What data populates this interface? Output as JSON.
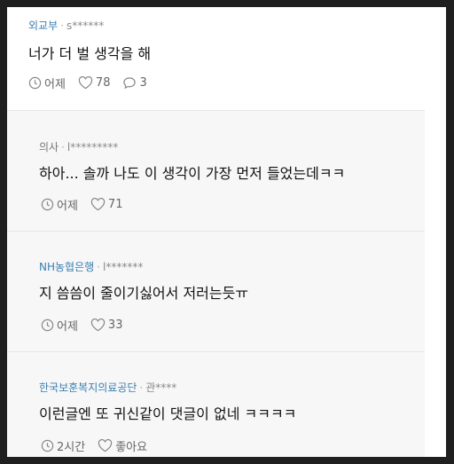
{
  "comments": [
    {
      "author": "외교부",
      "user": "s******",
      "text": "너가 더 벌 생각을 해",
      "time": "어제",
      "likes": "78",
      "replies": "3"
    },
    {
      "author": "의사",
      "user": "l*********",
      "text": "하아... 솔까 나도 이 생각이 가장 먼저 들었는데ㅋㅋ",
      "time": "어제",
      "likes": "71"
    },
    {
      "author": "NH농협은행",
      "user": "l*******",
      "text": "지 씀씀이 줄이기싫어서 저러는듯ㅠ",
      "time": "어제",
      "likes": "33"
    },
    {
      "author": "한국보훈복지의료공단",
      "user": "관****",
      "text": "이런글엔 또 귀신같이 댓글이 없네 ㅋㅋㅋㅋ",
      "time": "2시간",
      "likes": "좋아요"
    }
  ]
}
